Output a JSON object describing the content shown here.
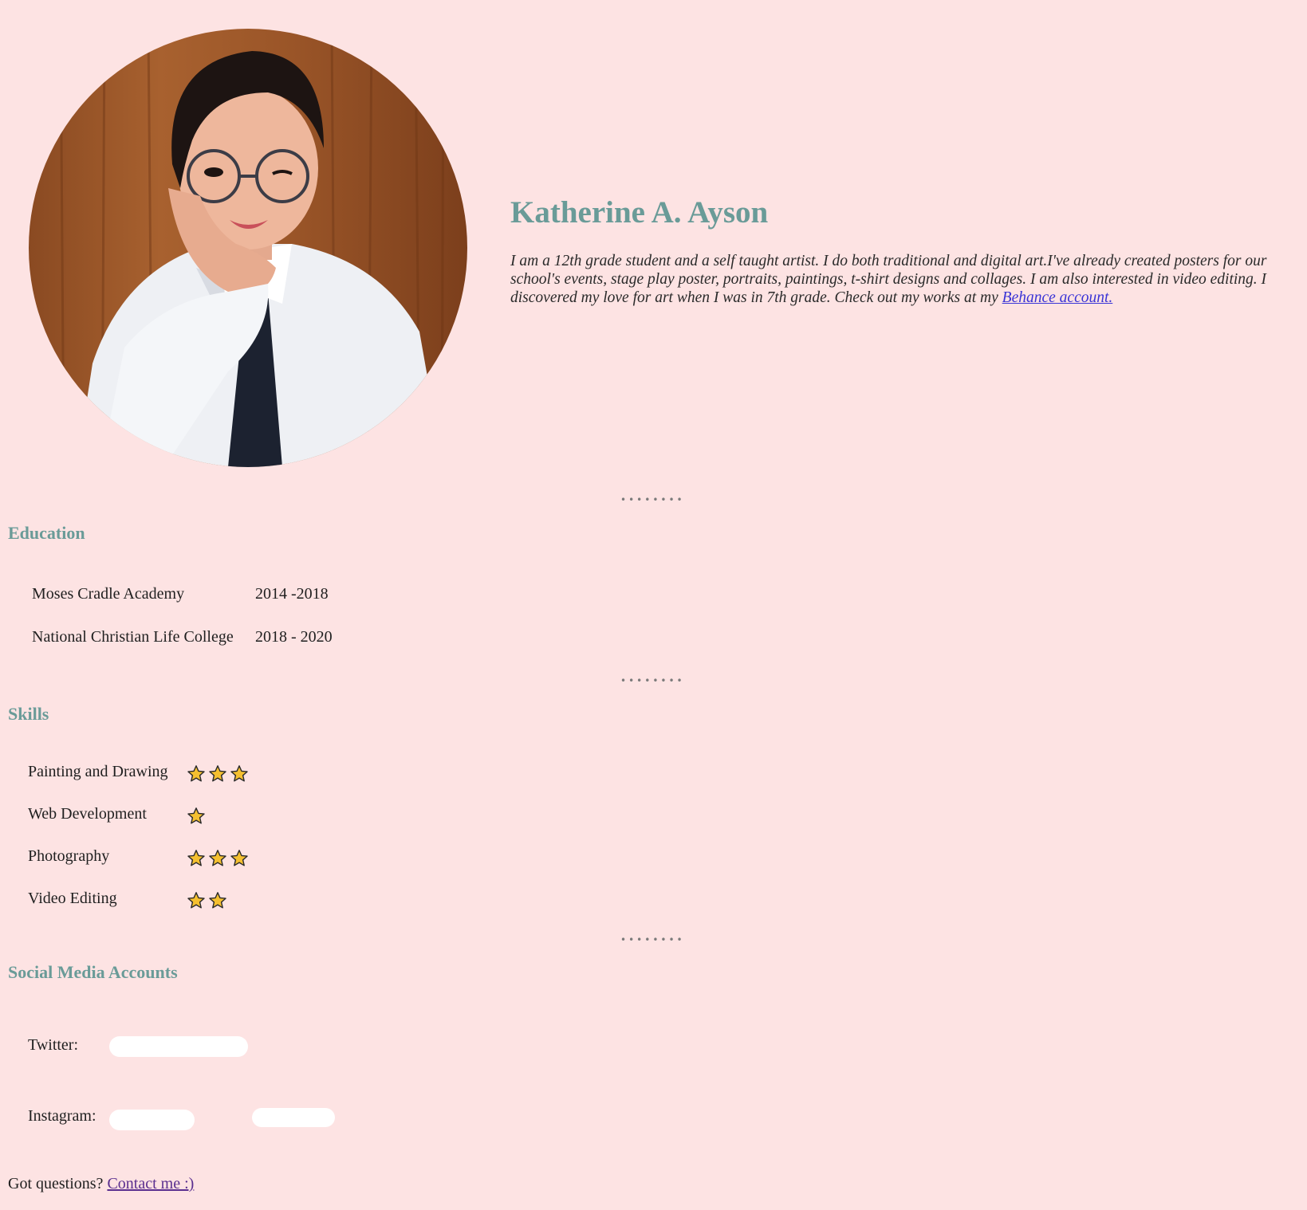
{
  "profile": {
    "name": "Katherine A. Ayson",
    "bio_text": "I am a 12th grade student and a self taught artist. I do both traditional and digital art.I've already created posters for our school's events, stage play poster, portraits, paintings, t-shirt designs and collages. I am also interested in video editing. I discovered my love for art when I was in 7th grade. Check out my works at my ",
    "bio_link": "Behance account."
  },
  "divider": "••••••••",
  "education": {
    "title": "Education",
    "rows": [
      {
        "school": "Moses Cradle Academy",
        "years": "2014 -2018"
      },
      {
        "school": "National Christian Life College",
        "years": "2018 - 2020"
      }
    ]
  },
  "skills": {
    "title": "Skills",
    "items": [
      {
        "label": "Painting and Drawing",
        "stars": 3
      },
      {
        "label": "Web Development",
        "stars": 1
      },
      {
        "label": "Photography",
        "stars": 3
      },
      {
        "label": "Video Editing",
        "stars": 2
      }
    ],
    "star_icon": "star-icon",
    "star_color": "#f5c030"
  },
  "social": {
    "title": "Social Media Accounts",
    "twitter_label": "Twitter:",
    "instagram_label": "Instagram:"
  },
  "footer": {
    "text": "Got questions? ",
    "link": "Contact me :)"
  },
  "colors": {
    "background": "#fde3e3",
    "heading": "#6a9b98",
    "link": "#3a34d6",
    "visited_link": "#5a2f8f"
  }
}
